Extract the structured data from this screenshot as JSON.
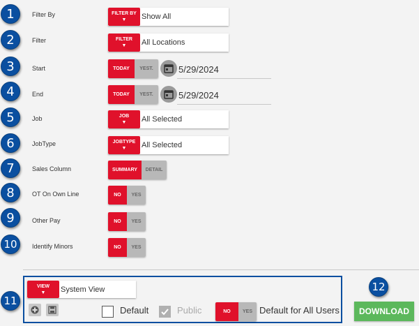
{
  "badges": [
    "1",
    "2",
    "3",
    "4",
    "5",
    "6",
    "7",
    "8",
    "9",
    "10",
    "11",
    "12"
  ],
  "filter_by": {
    "label": "Filter By",
    "tag": "FILTER BY",
    "value": "Show All"
  },
  "filter": {
    "label": "Filter",
    "tag": "FILTER",
    "value": "All Locations"
  },
  "start": {
    "label": "Start",
    "today": "TODAY",
    "yest": "YEST.",
    "date": "5/29/2024"
  },
  "end": {
    "label": "End",
    "today": "TODAY",
    "yest": "YEST.",
    "date": "5/29/2024"
  },
  "job": {
    "label": "Job",
    "tag": "JOB",
    "value": "All Selected"
  },
  "jobtype": {
    "label": "JobType",
    "tag": "JOBTYPE",
    "value": "All Selected"
  },
  "sales_column": {
    "label": "Sales Column",
    "on": "SUMMARY",
    "off": "DETAIL"
  },
  "ot_own_line": {
    "label": "OT On Own Line",
    "on": "NO",
    "off": "YES"
  },
  "other_pay": {
    "label": "Other Pay",
    "on": "NO",
    "off": "YES"
  },
  "identify_minors": {
    "label": "Identify Minors",
    "on": "NO",
    "off": "YES"
  },
  "view": {
    "tag": "VIEW",
    "value": "System View",
    "default_label": "Default",
    "public_label": "Public",
    "default_all_on": "NO",
    "default_all_off": "YES",
    "default_all_label": "Default for All Users",
    "default_checked": false,
    "public_checked": true
  },
  "download_label": "DOWNLOAD",
  "colors": {
    "accent": "#e0112b",
    "badge": "#0a4fa0",
    "download": "#5cb85c"
  },
  "icons": [
    "calendar-icon",
    "add-icon",
    "save-icon",
    "check-icon",
    "caret-down-icon"
  ]
}
